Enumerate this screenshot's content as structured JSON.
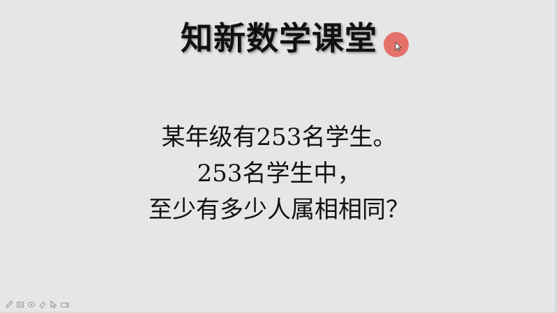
{
  "slide": {
    "title": "知新数学课堂",
    "question_lines": [
      "某年级有253名学生。",
      "253名学生中，",
      "至少有多少人属相相同？"
    ]
  },
  "pointer": {
    "color": "#e4675f"
  },
  "toolbar": {
    "tools": [
      "pen-icon",
      "slide-icon",
      "highlighter-icon",
      "eraser-icon",
      "arrow-icon",
      "camera-icon"
    ]
  }
}
